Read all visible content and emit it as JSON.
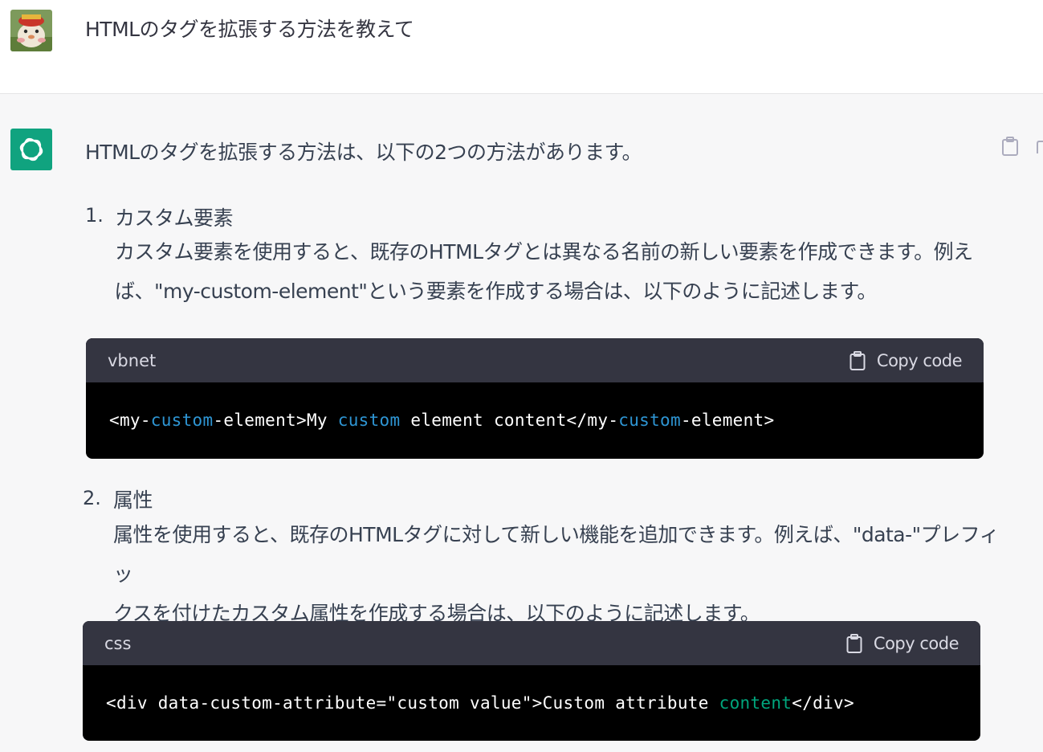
{
  "user": {
    "message": "HTMLのタグを拡張する方法を教えて"
  },
  "assistant": {
    "intro": "HTMLのタグを拡張する方法は、以下の2つの方法があります。",
    "items": [
      {
        "number": "1.",
        "title": "カスタム要素",
        "para_line1": "カスタム要素を使用すると、既存のHTMLタグとは異なる名前の新しい要素を作成できます。例え",
        "para_line2": "ば、\"my-custom-element\"という要素を作成する場合は、以下のように記述します。",
        "code": {
          "language": "vbnet",
          "copy_label": "Copy code",
          "tokens": [
            "<my-",
            "custom",
            "-element>My ",
            "custom",
            " element content</my-",
            "custom",
            "-element>"
          ]
        }
      },
      {
        "number": "2.",
        "title": "属性",
        "para_line1": "属性を使用すると、既存のHTMLタグに対して新しい機能を追加できます。例えば、\"data-\"プレフィッ",
        "para_line2": "クスを付けたカスタム属性を作成する場合は、以下のように記述します。",
        "code": {
          "language": "css",
          "copy_label": "Copy code",
          "tokens": [
            "<div data-custom-attribute=\"custom value\">Custom attribute ",
            "content",
            "</div>"
          ]
        }
      }
    ]
  },
  "colors": {
    "brand_green": "#10a37f",
    "code_header_bg": "#343541",
    "code_bg": "#000000",
    "token_keyword": "#2e95d3",
    "token_string": "#00a67d"
  },
  "icons": {
    "user_avatar": "user-avatar",
    "bot_avatar": "openai-logo-icon",
    "clipboard": "clipboard-icon",
    "thumb": "thumbs-up-icon"
  }
}
